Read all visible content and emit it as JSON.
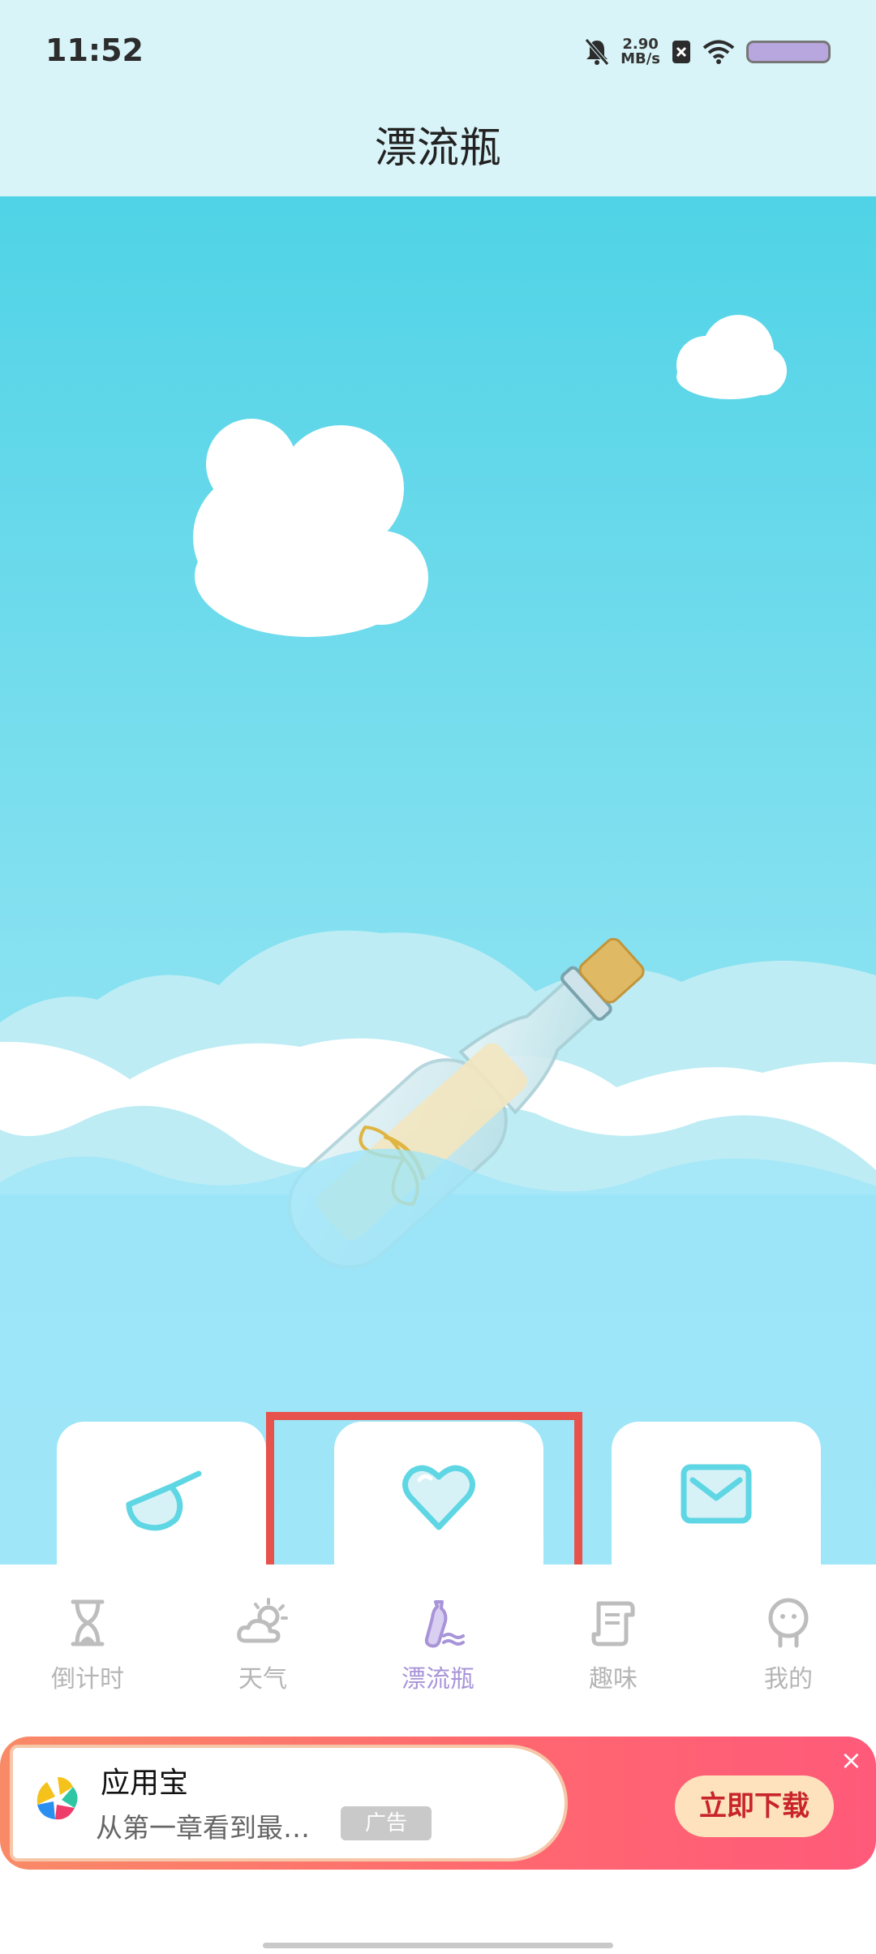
{
  "status_bar": {
    "time": "11:52",
    "net_speed_value": "2.90",
    "net_speed_unit": "MB/s"
  },
  "header": {
    "title": "漂流瓶"
  },
  "actions": [
    {
      "name": "scoop-button",
      "icon": "net-icon"
    },
    {
      "name": "heart-button",
      "icon": "heart-icon"
    },
    {
      "name": "mail-button",
      "icon": "envelope-icon"
    }
  ],
  "tabs": [
    {
      "label": "倒计时",
      "icon": "hourglass-icon"
    },
    {
      "label": "天气",
      "icon": "cloud-sun-icon"
    },
    {
      "label": "漂流瓶",
      "icon": "bottle-icon",
      "active": true
    },
    {
      "label": "趣味",
      "icon": "scroll-icon"
    },
    {
      "label": "我的",
      "icon": "person-icon"
    }
  ],
  "ad": {
    "app_name": "应用宝",
    "description": "从第一章看到最…",
    "tag": "广告",
    "cta": "立即下载",
    "close": "×"
  },
  "colors": {
    "accent": "#a894d8",
    "highlight": "#e8524c",
    "sky": "#4fd3e6"
  }
}
